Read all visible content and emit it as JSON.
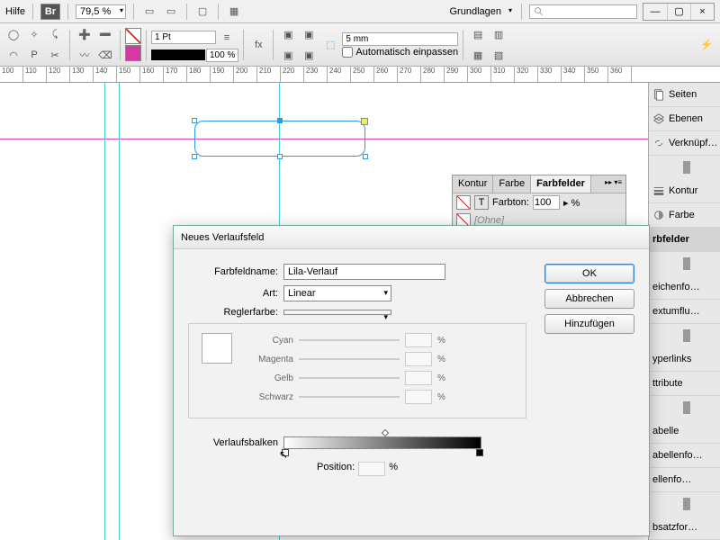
{
  "menubar": {
    "help": "Hilfe",
    "bridge": "Br",
    "zoom": "79,5 %",
    "workspace": "Grundlagen"
  },
  "toolbar": {
    "stroke_weight": "1 Pt",
    "opacity": "100 %",
    "frame_fit_value": "5 mm",
    "auto_fit": "Automatisch einpassen"
  },
  "ruler": [
    "100",
    "110",
    "120",
    "130",
    "140",
    "150",
    "160",
    "170",
    "180",
    "190",
    "200",
    "210",
    "220",
    "230",
    "240",
    "250",
    "260",
    "270",
    "280",
    "290",
    "300",
    "310",
    "320",
    "330",
    "340",
    "350",
    "360"
  ],
  "right_panel": {
    "seiten": "Seiten",
    "ebenen": "Ebenen",
    "verknupf": "Verknüpf…",
    "kontur": "Kontur",
    "farbe": "Farbe",
    "farbfelder": "rbfelder",
    "zeichenfo": "eichenfo…",
    "textumflu": "extumflu…",
    "hyperlinks": "yperlinks",
    "attribute": "ttribute",
    "tabelle": "abelle",
    "tabellenfo": "abellenfo…",
    "zellenfo": "ellenfo…",
    "absatzfor": "bsatzfor…"
  },
  "swatches_panel": {
    "tab_kontur": "Kontur",
    "tab_farbe": "Farbe",
    "tab_farbfelder": "Farbfelder",
    "farbton_label": "Farbton:",
    "farbton_value": "100",
    "ohne": "[Ohne]"
  },
  "dialog": {
    "title": "Neues Verlaufsfeld",
    "farbfeldname_label": "Farbfeldname:",
    "farbfeldname_value": "Lila-Verlauf",
    "art_label": "Art:",
    "art_value": "Linear",
    "reglerfarbe_label": "Reglerfarbe:",
    "cyan": "Cyan",
    "magenta": "Magenta",
    "gelb": "Gelb",
    "schwarz": "Schwarz",
    "verlaufsbalken": "Verlaufsbalken",
    "position_label": "Position:",
    "pct": "%",
    "ok": "OK",
    "abbrechen": "Abbrechen",
    "hinzufugen": "Hinzufügen"
  }
}
